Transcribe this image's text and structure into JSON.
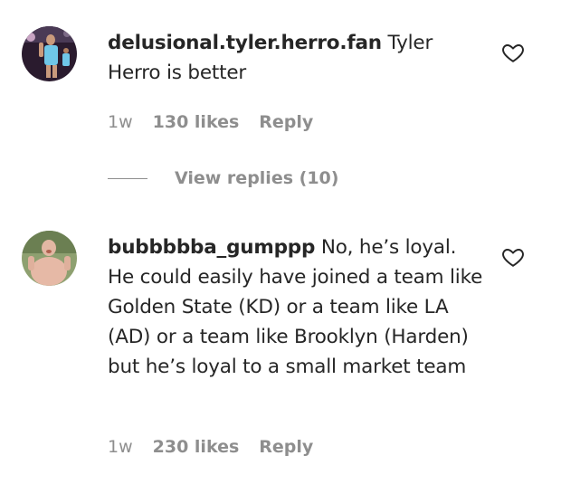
{
  "comments": [
    {
      "username": "delusional.tyler.herro.fan",
      "text": "Tyler Herro is better",
      "time": "1w",
      "likes": "130 likes",
      "reply": "Reply",
      "view_replies": "View replies (10)",
      "avatar_icon": "player-photo-avatar",
      "like_icon": "heart-outline-icon"
    },
    {
      "username": "bubbbbba_gumppp",
      "text": "No, he’s loyal. He could easily have joined a team like Golden State (KD) or a team like LA (AD) or a team like Brooklyn (Harden) but he’s loyal to a small market team",
      "time": "1w",
      "likes": "230 likes",
      "reply": "Reply",
      "avatar_icon": "person-photo-avatar",
      "like_icon": "heart-outline-icon"
    }
  ],
  "colors": {
    "text": "#262626",
    "secondary": "#8e8e8e"
  }
}
